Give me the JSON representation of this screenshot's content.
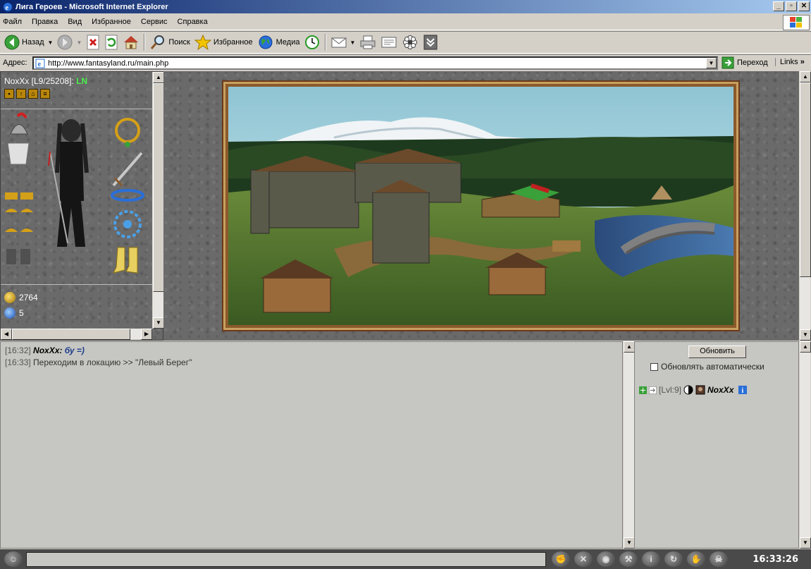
{
  "window": {
    "title": "Лига Героев - Microsoft Internet Explorer",
    "minimize": "_",
    "maximize": "▫",
    "close": "✕"
  },
  "menu": [
    "Файл",
    "Правка",
    "Вид",
    "Избранное",
    "Сервис",
    "Справка"
  ],
  "toolbar": {
    "back_label": "Назад",
    "search_label": "Поиск",
    "favorites_label": "Избранное",
    "media_label": "Медиа"
  },
  "address": {
    "label": "Адрес:",
    "url": "http://www.fantasyland.ru/main.php",
    "go_label": "Переход",
    "links_label": "Links"
  },
  "character": {
    "name": "NoxXx [L9/25208]:",
    "tag": "LN",
    "gold": "2764",
    "gems": "5"
  },
  "chat": {
    "lines": [
      {
        "time": "[16:32]",
        "nick": "NoxXx:",
        "text": "бу =)"
      },
      {
        "time": "[16:33]",
        "text": "Переходим в локацию >> \"Левый Берег\""
      }
    ]
  },
  "users_panel": {
    "refresh_label": "Обновить",
    "auto_refresh_label": "Обновлять автоматически",
    "auto_refresh_checked": false,
    "users": [
      {
        "level": "[Lvl:9]",
        "nick": "NoxXx"
      }
    ]
  },
  "status": {
    "clock": "16:33:26",
    "icons": [
      "fist-icon",
      "crossed-swords-icon",
      "eye-icon",
      "tools-icon",
      "info-icon",
      "refresh-icon",
      "hand-icon",
      "skull-icon"
    ]
  },
  "colors": {
    "title_gradient_start": "#0a246a",
    "title_gradient_end": "#a6caf0",
    "chat_message": "#1a3a8a",
    "level_tag": "#4cf04c"
  }
}
